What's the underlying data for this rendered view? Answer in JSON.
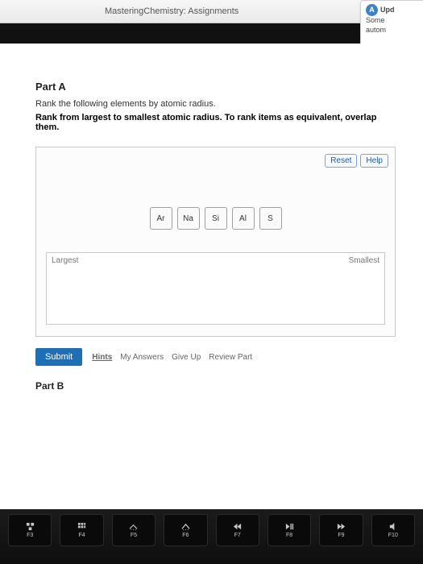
{
  "browser": {
    "tab_title": "MasteringChemistry: Assignments"
  },
  "update_panel": {
    "line1": "Upd",
    "line2": "Some",
    "line3": "autom"
  },
  "part_a": {
    "heading": "Part A",
    "line1": "Rank the following elements by atomic radius.",
    "line2": "Rank from largest to smallest atomic radius. To rank items as equivalent, overlap them.",
    "reset_label": "Reset",
    "help_label": "Help",
    "tiles": [
      "Ar",
      "Na",
      "Si",
      "Al",
      "S"
    ],
    "drop_left_label": "Largest",
    "drop_right_label": "Smallest"
  },
  "actions": {
    "submit": "Submit",
    "hints": "Hints",
    "my_answers": "My Answers",
    "give_up": "Give Up",
    "review_part": "Review Part"
  },
  "part_b": {
    "heading": "Part B"
  },
  "keyboard": {
    "keys": [
      {
        "top": "",
        "bottom": "F3"
      },
      {
        "top": "",
        "bottom": "F4"
      },
      {
        "top": "",
        "bottom": "F5"
      },
      {
        "top": "",
        "bottom": "F6"
      },
      {
        "top": "",
        "bottom": "F7"
      },
      {
        "top": "",
        "bottom": "F8"
      },
      {
        "top": "",
        "bottom": "F9"
      },
      {
        "top": "",
        "bottom": "F10"
      }
    ]
  }
}
